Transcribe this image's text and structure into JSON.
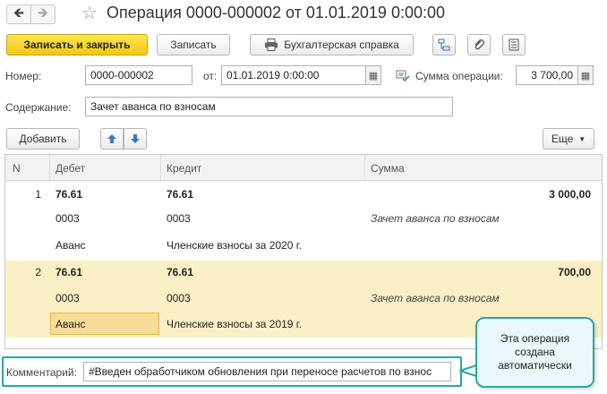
{
  "window": {
    "title": "Операция 0000-000002 от 01.01.2019 0:00:00"
  },
  "toolbar": {
    "save_close_label": "Записать и закрыть",
    "save_label": "Записать",
    "report_label": "Бухгалтерская справка"
  },
  "header": {
    "number_label": "Номер:",
    "number_value": "0000-000002",
    "date_label": "от:",
    "date_value": "01.01.2019  0:00:00",
    "sum_label": "Сумма операции:",
    "sum_value": "3 700,00",
    "content_label": "Содержание:",
    "content_value": "Зачет аванса по взносам"
  },
  "table_toolbar": {
    "add_label": "Добавить",
    "more_label": "Еще"
  },
  "table": {
    "columns": [
      "N",
      "Дебет",
      "Кредит",
      "Сумма"
    ],
    "rows": [
      {
        "n": "1",
        "debit": [
          "76.61",
          "0003",
          "Аванс"
        ],
        "credit": [
          "76.61",
          "0003",
          "Членские взносы за 2020 г."
        ],
        "sum": "3 000,00",
        "sum_note": "Зачет аванса по взносам"
      },
      {
        "n": "2",
        "debit": [
          "76.61",
          "0003",
          "Аванс"
        ],
        "credit": [
          "76.61",
          "0003",
          "Членские взносы за 2019 г."
        ],
        "sum": "700,00",
        "sum_note": "Зачет аванса по взносам"
      }
    ]
  },
  "footer": {
    "comment_label": "Комментарий:",
    "comment_value": "#Введен обработчиком обновления при переносе расчетов по взнос"
  },
  "callout": {
    "text": "Эта операция создана автоматически"
  },
  "colors": {
    "accent_yellow": "#f2c711",
    "selection": "#fbefc6",
    "callout_border": "#2aa7a7"
  }
}
